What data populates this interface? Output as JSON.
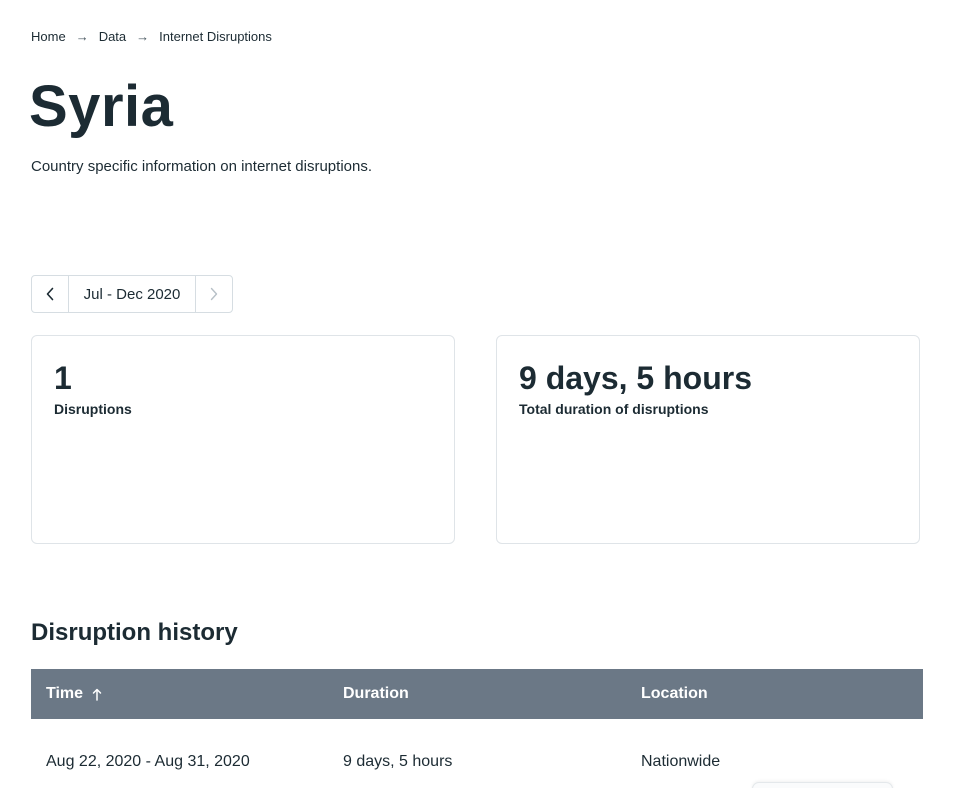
{
  "breadcrumb": {
    "items": [
      "Home",
      "Data",
      "Internet Disruptions"
    ],
    "separator": "→"
  },
  "page": {
    "title": "Syria",
    "subtitle": "Country specific information on internet disruptions."
  },
  "period_selector": {
    "label": "Jul - Dec 2020",
    "prev_icon": "chevron-left-icon",
    "next_icon": "chevron-right-icon",
    "next_disabled": true
  },
  "stats": {
    "disruptions": {
      "value": "1",
      "caption": "Disruptions"
    },
    "duration": {
      "value": "9 days, 5 hours",
      "caption": "Total duration of disruptions"
    }
  },
  "history": {
    "title": "Disruption history",
    "columns": {
      "time": "Time",
      "duration": "Duration",
      "location": "Location"
    },
    "sort_icon": "arrow-up-icon",
    "rows": [
      {
        "time": "Aug 22, 2020 - Aug 31, 2020",
        "duration": "9 days, 5 hours",
        "location": "Nationwide"
      }
    ]
  },
  "colors": {
    "text": "#1c2b33",
    "table_header_bg": "#6b7886",
    "border": "#dfe4e8"
  }
}
